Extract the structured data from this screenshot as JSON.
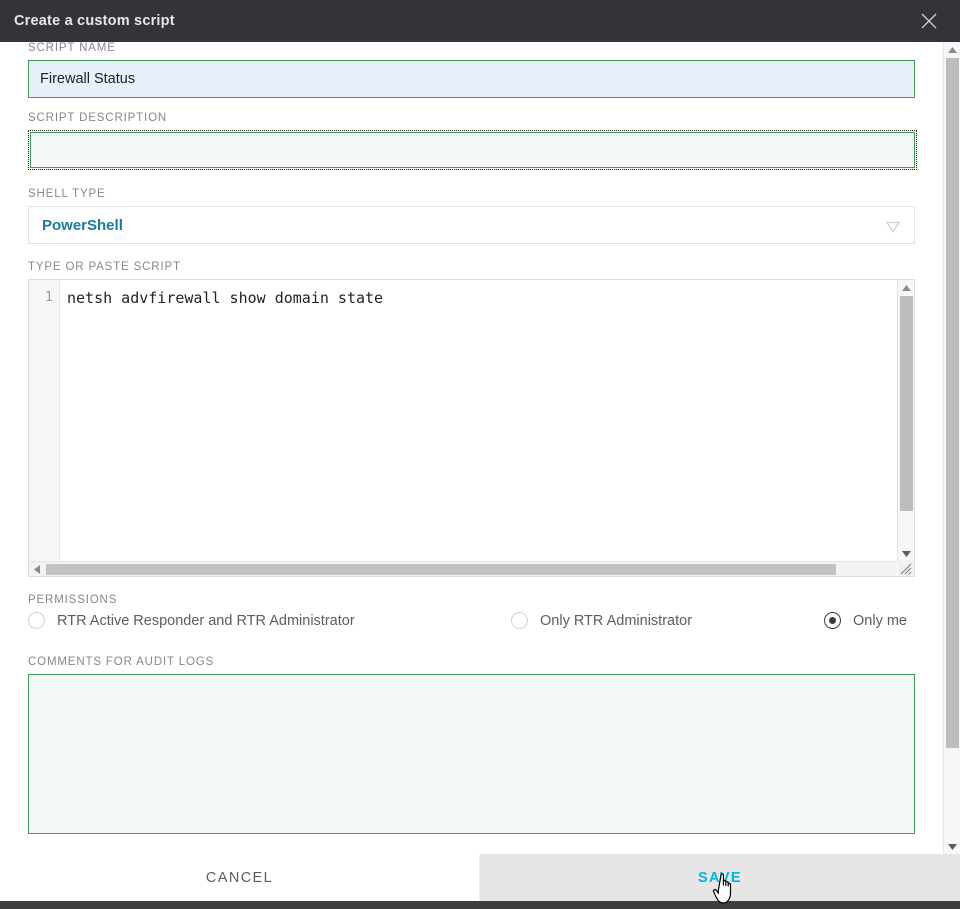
{
  "header": {
    "title": "Create a custom script",
    "close_icon": "close-icon"
  },
  "form": {
    "script_name": {
      "label": "SCRIPT NAME",
      "value": "Firewall Status",
      "placeholder": ""
    },
    "script_description": {
      "label": "SCRIPT DESCRIPTION",
      "value": "",
      "placeholder": ""
    },
    "shell_type": {
      "label": "SHELL TYPE",
      "value": "PowerShell",
      "caret_icon": "chevron-down-icon"
    },
    "script_editor": {
      "label": "TYPE OR PASTE SCRIPT",
      "line_number": "1",
      "code": "netsh advfirewall show domain state",
      "scroll_up_icon": "arrow-up-icon",
      "scroll_down_icon": "arrow-down-icon",
      "scroll_left_icon": "arrow-left-icon",
      "resize_grip_icon": "resize-grip-icon"
    },
    "permissions": {
      "label": "PERMISSIONS",
      "options": [
        {
          "label": "RTR Active Responder and RTR Administrator",
          "selected": false
        },
        {
          "label": "Only RTR Administrator",
          "selected": false
        },
        {
          "label": "Only me",
          "selected": true
        }
      ]
    },
    "comments": {
      "label": "COMMENTS FOR AUDIT LOGS",
      "value": "",
      "placeholder": ""
    }
  },
  "body_scrollbar": {
    "up_icon": "arrow-up-icon",
    "down_icon": "arrow-down-icon"
  },
  "footer": {
    "cancel_label": "CANCEL",
    "save_label": "SAVE"
  },
  "cursor": {
    "icon": "pointer-hand-cursor"
  },
  "colors": {
    "header_bg": "#333338",
    "field_border_green": "#3f9c57",
    "autofill_blue": "#e8f0fe",
    "shell_value_teal": "#197b9e",
    "save_cyan": "#00b4e6",
    "label_gray": "#85878b"
  }
}
